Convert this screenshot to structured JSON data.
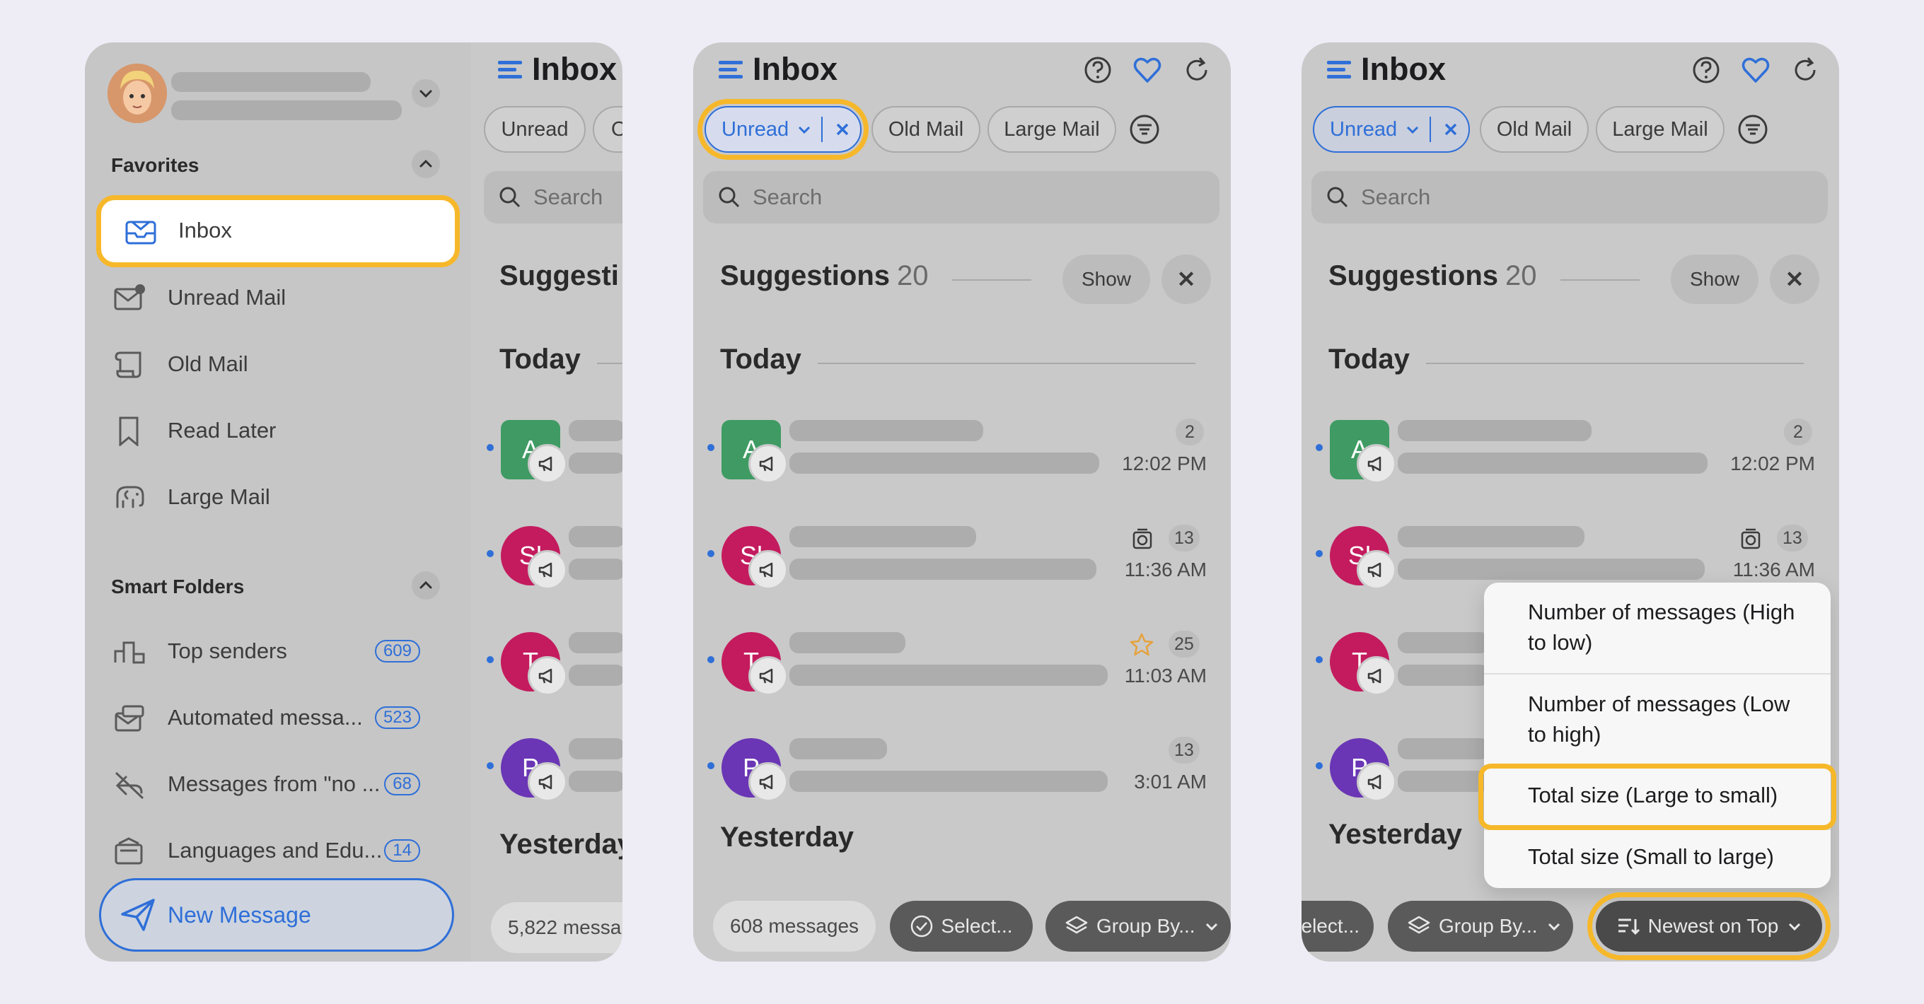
{
  "sidebar": {
    "favorites_title": "Favorites",
    "items": [
      {
        "label": "Inbox"
      },
      {
        "label": "Unread Mail"
      },
      {
        "label": "Old Mail"
      },
      {
        "label": "Read Later"
      },
      {
        "label": "Large Mail"
      }
    ],
    "smart_title": "Smart Folders",
    "smart": [
      {
        "label": "Top senders",
        "count": "609"
      },
      {
        "label": "Automated messa...",
        "count": "523"
      },
      {
        "label": "Messages from \"no ...",
        "count": "68"
      },
      {
        "label": "Languages and Edu...",
        "count": "14"
      }
    ],
    "new_message": "New Message"
  },
  "panel1": {
    "title": "Inbox",
    "chips": [
      "Unread",
      "O"
    ],
    "search_placeholder": "Search",
    "suggestions_label": "Suggesti",
    "today": "Today",
    "avatars": [
      "A",
      "Sl",
      "T",
      "P"
    ],
    "yesterday": "Yesterday",
    "count_pill": "5,822 messa"
  },
  "panel2": {
    "title": "Inbox",
    "chips": {
      "unread": "Unread",
      "old": "Old Mail",
      "large": "Large Mail"
    },
    "search_placeholder": "Search",
    "suggestions_label": "Suggestions",
    "suggestions_count": "20",
    "show": "Show",
    "today": "Today",
    "rows": [
      {
        "avatar": "A",
        "color": "#3f9b63",
        "badge": "2",
        "time": "12:02 PM"
      },
      {
        "avatar": "Sl",
        "color": "#c41b5e",
        "badge": "13",
        "time": "11:36 AM"
      },
      {
        "avatar": "T",
        "color": "#c41b5e",
        "badge": "25",
        "time": "11:03 AM"
      },
      {
        "avatar": "P",
        "color": "#6a36b5",
        "badge": "13",
        "time": "3:01 AM"
      }
    ],
    "yesterday": "Yesterday",
    "count_pill": "608 messages",
    "select": "Select...",
    "group_by": "Group By..."
  },
  "panel3": {
    "title": "Inbox",
    "chips": {
      "unread": "Unread",
      "old": "Old Mail",
      "large": "Large Mail"
    },
    "search_placeholder": "Search",
    "suggestions_label": "Suggestions",
    "suggestions_count": "20",
    "show": "Show",
    "today": "Today",
    "rows": [
      {
        "avatar": "A",
        "badge": "2",
        "time": "12:02 PM"
      },
      {
        "avatar": "Sl",
        "badge": "13",
        "time": "11:36 AM"
      },
      {
        "avatar": "T"
      },
      {
        "avatar": "P"
      }
    ],
    "yesterday": "Yesterday",
    "select": "elect...",
    "group_by": "Group By...",
    "sort": "Newest on Top",
    "sort_menu": [
      "Number of messages (High to low)",
      "Number of messages (Low to high)",
      "Total size (Large to small)",
      "Total size (Small to large)"
    ]
  },
  "colors": {
    "accent": "#2f6fd8",
    "highlight": "#f6b82a",
    "green": "#3f9b63",
    "crimson": "#c41b5e",
    "purple": "#6a36b5"
  }
}
